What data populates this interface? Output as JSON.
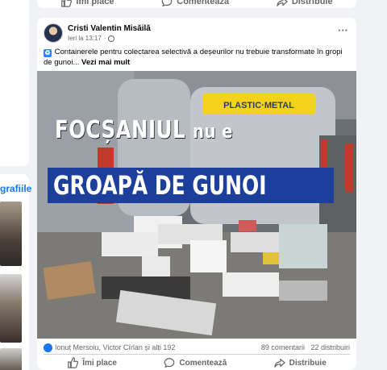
{
  "left": {
    "photos_link": "grafiile"
  },
  "previous_post": {
    "like_label": "Îmi place",
    "comment_label": "Comentează",
    "share_label": "Distribuie"
  },
  "post": {
    "author": "Cristi Valentin Misăilă",
    "time": "Ieri la 13:17",
    "separator": "·",
    "audience_icon": "globe-icon",
    "text": "Containerele pentru colectarea selectivă a deșeurilor nu trebuie transformate în gropi de gunoi...",
    "see_more": "Vezi mai mult",
    "image": {
      "container_label": "PLASTIC·METAL",
      "headline_line1_a": "FOCȘANIUL",
      "headline_line1_b": "nu e",
      "headline_line2": "GROAPĂ DE GUNOI"
    },
    "reactions_text": "Ionuț Mersoiu, Victor Cîrlan și alți 192",
    "comments": "89 comentarii",
    "shares": "22 distribuiri",
    "like_label": "Îmi place",
    "comment_label": "Comentează",
    "share_label": "Distribuie"
  },
  "colors": {
    "accent": "#1877f2",
    "banner": "#1c3f9c",
    "container_yellow": "#f2d21b"
  }
}
